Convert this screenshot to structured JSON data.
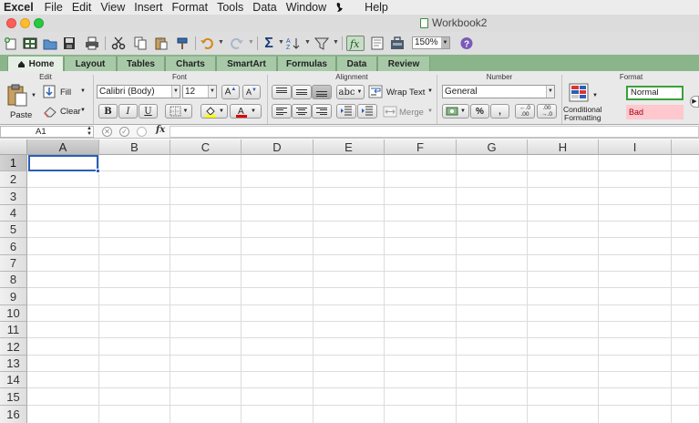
{
  "menubar": {
    "app": "Excel",
    "items": [
      "File",
      "Edit",
      "View",
      "Insert",
      "Format",
      "Tools",
      "Data",
      "Window",
      "Help"
    ],
    "script_icon": "script-menu-icon"
  },
  "window": {
    "title": "Workbook2",
    "traffic_lights": {
      "close": "#fc5f57",
      "minimize": "#fdbc2e",
      "zoom": "#2ac841"
    }
  },
  "toolbar": {
    "zoom": "150%"
  },
  "tabs": [
    "Home",
    "Layout",
    "Tables",
    "Charts",
    "SmartArt",
    "Formulas",
    "Data",
    "Review"
  ],
  "ribbon": {
    "groups": {
      "edit": "Edit",
      "font": "Font",
      "alignment": "Alignment",
      "number": "Number",
      "format": "Format"
    },
    "paste_label": "Paste",
    "fill_label": "Fill",
    "clear_label": "Clear",
    "font_name": "Calibri (Body)",
    "font_size": "12",
    "bold": "B",
    "italic": "I",
    "underline": "U",
    "abc": "abc",
    "wrap_text": "Wrap Text",
    "merge": "Merge",
    "number_format": "General",
    "percent": "%",
    "comma": ",",
    "inc_decimal_a": "←.0",
    "inc_decimal_b": ".00",
    "dec_decimal_a": ".00",
    "dec_decimal_b": "→.0",
    "conditional_1": "Conditional",
    "conditional_2": "Formatting",
    "style_normal": "Normal",
    "style_bad": "Bad"
  },
  "formula_bar": {
    "name_box": "A1",
    "fx": "fx",
    "value": ""
  },
  "sheet": {
    "columns": [
      "A",
      "B",
      "C",
      "D",
      "E",
      "F",
      "G",
      "H",
      "I"
    ],
    "rows": [
      "1",
      "2",
      "3",
      "4",
      "5",
      "6",
      "7",
      "8",
      "9",
      "10",
      "11",
      "12",
      "13",
      "14",
      "15",
      "16"
    ],
    "active_cell": "A1"
  },
  "colors": {
    "tab_bar": "#8ab58a",
    "selection": "#2a5fb5",
    "bad_fill": "#ffc7ce",
    "bad_text": "#9c0006",
    "normal_border": "#3aa13a"
  }
}
